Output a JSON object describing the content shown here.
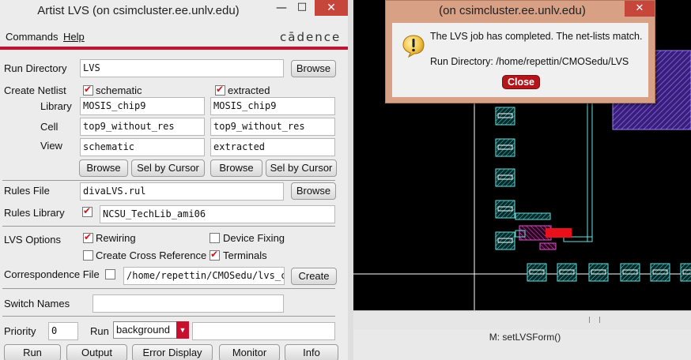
{
  "lvs_window": {
    "title": "Artist LVS (on csimcluster.ee.unlv.edu)",
    "controls": {
      "minimize": "—",
      "maximize": "□",
      "close": "✕"
    },
    "menu": {
      "commands": "Commands",
      "help": "Help",
      "brand": "cādence"
    },
    "run_directory": {
      "label": "Run Directory",
      "value": "LVS",
      "browse": "Browse"
    },
    "create_netlist": {
      "label": "Create Netlist",
      "schematic_checkbox": "schematic",
      "extracted_checkbox": "extracted",
      "library_label": "Library",
      "cell_label": "Cell",
      "view_label": "View",
      "schematic": {
        "library": "MOSIS_chip9",
        "cell": "top9_without_res",
        "view": "schematic"
      },
      "extracted": {
        "library": "MOSIS_chip9",
        "cell": "top9_without_res",
        "view": "extracted"
      },
      "browse": "Browse",
      "sel_by_cursor": "Sel by Cursor"
    },
    "rules_file": {
      "label": "Rules File",
      "value": "divaLVS.rul",
      "browse": "Browse"
    },
    "rules_library": {
      "label": "Rules Library",
      "value": "NCSU_TechLib_ami06"
    },
    "lvs_options": {
      "label": "LVS Options",
      "rewiring": "Rewiring",
      "device_fixing": "Device Fixing",
      "create_cross_reference": "Create Cross Reference",
      "terminals": "Terminals"
    },
    "correspondence_file": {
      "label": "Correspondence File",
      "value": "/home/repettin/CMOSedu/lvs_c",
      "create": "Create"
    },
    "switch_names": {
      "label": "Switch Names",
      "value": ""
    },
    "priority": {
      "label": "Priority",
      "value": "0",
      "run_label": "Run",
      "run_mode": "background",
      "extra": ""
    },
    "bottom_buttons": {
      "run": "Run",
      "output": "Output",
      "error_display": "Error Display",
      "monitor": "Monitor",
      "info": "Info"
    }
  },
  "dialog": {
    "title": "(on csimcluster.ee.unlv.edu)",
    "message": "The LVS job has completed. The net-lists match.",
    "run_directory": "Run Directory: /home/repettin/CMOSedu/LVS",
    "close_button": "Close",
    "close_icon": "✕"
  },
  "layout_view": {
    "status": "M: setLVSForm()",
    "scroll_grip": "|||"
  },
  "colors": {
    "accent_red": "#c8102e",
    "layout_background": "#000000",
    "dialog_frame": "#d8a085",
    "close_button": "#b3151a"
  },
  "icons": {
    "dialog": "warning-icon"
  }
}
